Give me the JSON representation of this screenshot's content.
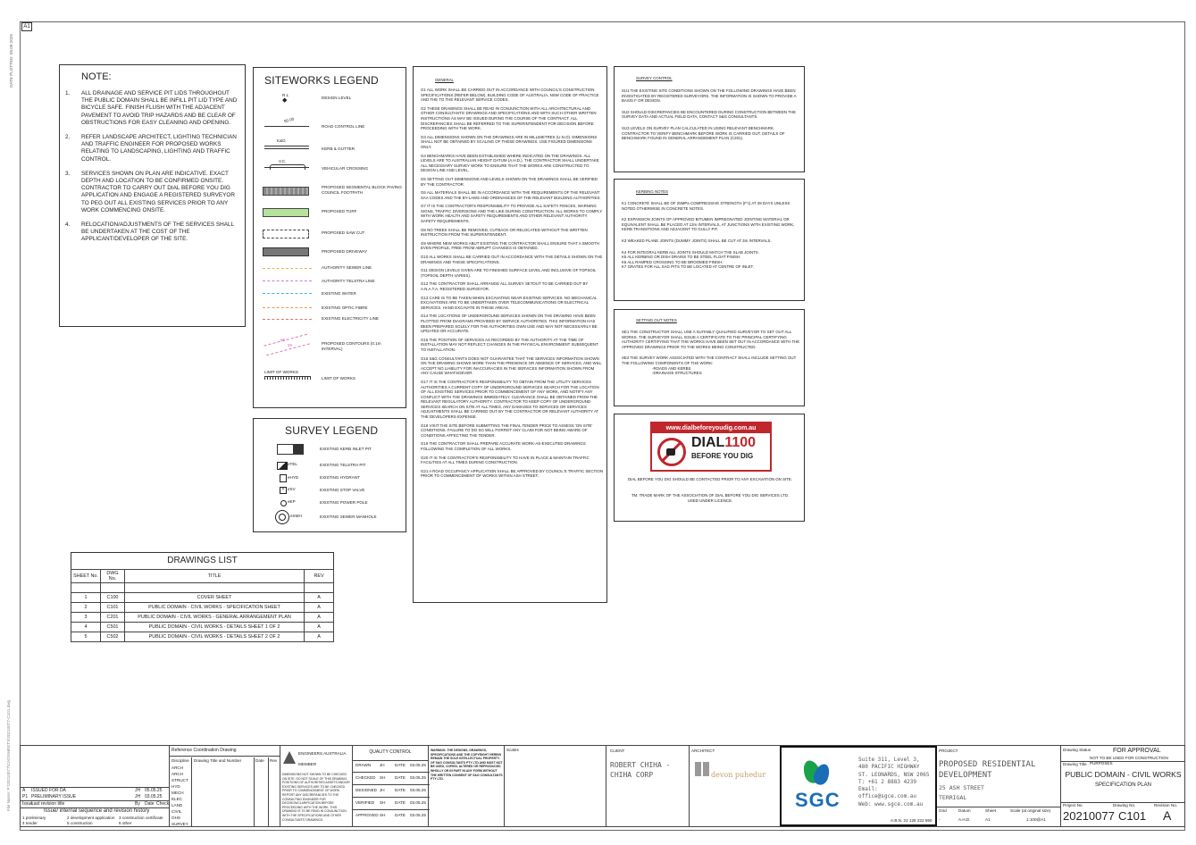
{
  "sheet_size": "A1",
  "side_text": "DATE PLOTTED: 05.05.2025",
  "side_text_2": "File Name: P:\\20210077\\CAD\\SHEETS\\20210077-C101.dwg",
  "note": {
    "title": "NOTE:",
    "items": [
      {
        "num": "1.",
        "text": "ALL DRAINAGE AND SERVICE PIT LIDS THROUGHOUT THE PUBLIC DOMAIN SHALL BE INFILL PIT LID TYPE AND BICYCLE SAFE. FINISH FLUSH WITH THE ADJACENT PAVEMENT TO AVOID TRIP HAZARDS AND BE CLEAR OF OBSTRUCTIONS FOR EASY CLEANING AND OPENING."
      },
      {
        "num": "2.",
        "text": "REFER LANDSCAPE ARCHITECT, LIGHTING TECHNICIAN AND TRAFFIC ENGINEER FOR PROPOSED WORKS RELATING TO LANDSCAPING, LIGHTING AND TRAFFIC CONTROL."
      },
      {
        "num": "3.",
        "text": "SERVICES SHOWN ON PLAN ARE INDICATIVE. EXACT DEPTH AND LOCATION TO BE CONFIRMED ONSITE. CONTRACTOR TO CARRY OUT DIAL BEFORE YOU DIG APPLICATION AND ENGAGE A REGISTERED SURVEYOR TO PEG OUT ALL EXISTING SERVICES PRIOR TO ANY WORK COMMENCING ONSITE."
      },
      {
        "num": "4.",
        "text": "RELOCATION/ADJUSTMENTS OF THE SERVICES SHALL BE UNDERTAKEN AT THE COST OF THE APPLICANT/DEVELOPER OF THE SITE."
      }
    ]
  },
  "siteworks_legend": {
    "title": "SITEWORKS LEGEND",
    "sym_rl": "R.L",
    "sym_rl_val": "4",
    "sym_road": "50.00",
    "sym_kg": "K&G",
    "sym_vc": "V.C.",
    "limit_text": "LIMIT OF WORKS",
    "contour_1": "88",
    "contour_2": "89",
    "items": [
      "DESIGN LEVEL",
      "ROAD CONTROL LINE",
      "KERB & GUTTER",
      "VEHICULAR CROSSING",
      "PROPOSED SEGMENTAL BLOCK PAVING COUNCIL FOOTPATH",
      "PROPOSED TURF",
      "PROPOSED SAW CUT",
      "PROPOSED DRIVEWAY",
      "AUTHORITY SEWER LINE",
      "AUTHORITY TELSTRA LINE",
      "EXISTING WATER",
      "EXISTING OPTIC FIBRE",
      "EXISTING ELECTRICITY LINE",
      "PROPOSED CONTOURS (0.1m INTERVAL)",
      "LIMIT OF WORKS"
    ]
  },
  "survey_legend": {
    "title": "SURVEY LEGEND",
    "items": [
      {
        "tag": "",
        "label": "EXISTING KERB INLET PIT"
      },
      {
        "tag": "eTEL",
        "label": "EXISTING TELSTRA PIT"
      },
      {
        "tag": "eHYD",
        "label": "EXISTING HYDRANT"
      },
      {
        "tag": "eSV",
        "label": "EXISTING STOP VALVE"
      },
      {
        "tag": "eEP",
        "label": "EXISTING POWER POLE"
      },
      {
        "tag": "eSMH",
        "label": "EXISTING SEWER MANHOLE"
      }
    ]
  },
  "drawings_list": {
    "title": "DRAWINGS LIST",
    "headers": [
      "SHEET No.",
      "DWG No.",
      "TITLE",
      "REV"
    ],
    "rows": [
      [
        "1",
        "C100",
        "COVER SHEET",
        "A"
      ],
      [
        "2",
        "C101",
        "PUBLIC DOMAIN - CIVIL WORKS - SPECIFICATION SHEET",
        "A"
      ],
      [
        "3",
        "C201",
        "PUBLIC DOMAIN - CIVIL WORKS - GENERAL ARRANGEMENT PLAN",
        "A"
      ],
      [
        "4",
        "C501",
        "PUBLIC DOMAIN - CIVIL WORKS - DETAILS SHEET 1 OF 2",
        "A"
      ],
      [
        "5",
        "C502",
        "PUBLIC DOMAIN - CIVIL WORKS - DETAILS SHEET 2 OF 2",
        "A"
      ]
    ]
  },
  "general": {
    "title": "GENERAL",
    "items": [
      "G1  ALL WORK SHALL BE CARRIED OUT IN ACCORDANCE WITH COUNCIL'S CONSTRUCTION SPECIFICATIONS (REFER BELOW), BUILDING CODE OF AUSTRALIA, NSW CODE OF PRACTICE AND THE TO THE RELEVANT SERVICE CODES.",
      "G2  THESE DRAWINGS SHALL BE READ IN CONJUNCTION WITH ALL ARCHITECTURAL AND OTHER CONSULTANTS' DRAWINGS AND SPECIFICATIONS AND WITH SUCH OTHER WRITTEN INSTRUCTIONS AS MAY BE ISSUED DURING THE COURSE OF THE CONTRACT. ALL DISCREPANCIES SHALL BE REFERRED TO THE SUPERINTENDENT FOR DECISION BEFORE PROCEEDING WITH THE WORK.",
      "G3  ALL DIMENSIONS SHOWN ON THE DRAWINGS ARE IN MILLIMETRES (U.N.O). DIMENSIONS SHALL NOT BE OBTAINED BY SCALING OF THESE DRAWINGS. USE FIGURED DIMENSIONS ONLY.",
      "G4  BENCHMARKS HAVE BEEN ESTABLISHED WHERE INDICATED ON THE DRAWINGS. ALL LEVELS ARE TO AUSTRALIAN HEIGHT DATUM (A.H.D.). THE CONTRACTOR SHALL UNDERTAKE ALL NECESSARY SURVEY WORK TO ENSURE THAT THE WORKS ARE CONSTRUCTED TO DESIGN LINE AND LEVEL.",
      "G5  SETTING OUT DIMENSIONS AND LEVELS SHOWN ON THE DRAWINGS SHALL BE VERIFIED BY THE CONTRACTOR.",
      "G6  ALL MATERIALS SHALL BE IN ACCORDANCE WITH THE REQUIREMENTS OF THE RELEVANT SAA CODES AND THE BY-LAWS AND ORDINANCES OF THE RELEVANT BUILDING AUTHORITIES.",
      "G7  IT IS THE CONTRACTOR'S RESPONSIBILITY TO PROVIDE ALL SAFETY FENCES, WARNING SIGNS, TRAFFIC DIVERSIONS AND THE LIKE DURING CONSTRUCTION. ALL WORKS TO COMPLY WITH WORK HEALTH AND SAFETY REQUIREMENTS AND OTHER RELEVANT AUTHORITY SAFETY REQUIREMENTS.",
      "G8  NO TREES SHALL BE REMOVED, CUTBACK OR RELOCATED WITHOUT THE WRITTEN INSTRUCTION FROM THE SUPERINTENDENT.",
      "G9  WHERE NEW WORKS ABUT EXISTING THE CONTRACTOR SHALL ENSURE THAT A SMOOTH EVEN PROFILE, FREE FROM ABRUPT CHANGES IS OBTAINED.",
      "G10  ALL WORKS SHALL BE CARRIED OUT IN ACCORDANCE WITH THE DETAILS SHOWN ON THE DRAWINGS AND THESE SPECIFICATIONS.",
      "G11  DESIGN LEVELS GIVEN ARE TO FINISHED SURFACE LEVEL AND INCLUSIVE OF TOPSOIL (TOPSOIL DEPTH VARIES).",
      "G12  THE CONTRACTOR SHALL ARRANGE ALL SURVEY SETOUT TO BE CARRIED OUT BY A.N.A.T.A. REGISTERED SURVEYOR.",
      "G13  CARE IS TO BE TAKEN WHEN EXCAVATING NEAR EXISTING SERVICES. NO MECHANICAL EXCAVATIONS ARE TO BE UNDERTAKEN OVER TELECOMMUNICATIONS OR ELECTRICAL SERVICES. HAND EXCAVATE IN THESE AREAS.",
      "G14  THE LOCATIONS OF UNDERGROUND SERVICES SHOWN ON THE DRAWING HAVE BEEN PLOTTED FROM DIAGRAMS PROVIDED BY SERVICE AUTHORITIES. THIS INFORMATION HAS BEEN PREPARED SOLELY FOR THE AUTHORITIES OWN USE AND MAY NOT NECESSARILY BE UPDATED OR ACCURATE.",
      "G15  THE POSITION OF SERVICES AS RECORDED BY THE AUTHORITY AT THE TIME OF INSTALLATION MAY NOT REFLECT CHANGES IN THE PHYSICAL ENVIRONMENT SUBSEQUENT TO INSTALLATION.",
      "G16  S&G CONSULTANTS DOES NOT GUARANTEE THAT THE SERVICES INFORMATION SHOWN ON THE DRAWING SHOWS MORE THAN THE PRESENCE OR ABSENCE OF SERVICES, AND WILL ACCEPT NO LIABILITY FOR INACCURACIES IN THE SERVICES INFORMATION SHOWN FROM ANY CAUSE WHATSOEVER.",
      "G17  IT IS THE CONTRACTOR'S RESPONSIBILITY TO OBTAIN FROM THE UTILITY SERVICES AUTHORITIES A CURRENT COPY OF UNDERGROUND SERVICES SEARCH FOR THE LOCATION OF ALL EXISTING SERVICES PRIOR TO COMMENCEMENT OF ANY WORK, AND NOTIFY ANY CONFLICT WITH THE DRAWINGS IMMEDIATELY. CLEARANCE SHALL BE OBTAINED FROM THE RELEVANT REGULATORY AUTHORITY. CONTRACTOR TO KEEP COPY OF UNDERGROUND SERVICES SEARCH ON SITE AT ALL TIMES. ANY DAMAGES TO SERVICES OR SERVICES ADJUSTMENTS SHALL BE CARRIED OUT BY THE CONTRACTOR OR RELEVANT AUTHORITY AT THE DEVELOPERS EXPENSE.",
      "G18  VISIT THE SITE BEFORE SUBMITTING THE FINAL TENDER PRICE TO ASSESS 'ON SITE' CONDITIONS. FAILURE TO DO SO WILL FORFEIT ANY CLAIM FOR NOT BEING AWARE OF CONDITIONS AFFECTING THE TENDER.",
      "G19  THE CONTRACTOR SHALL PREPARE ACCURATE WORK-AS-EXECUTED DRAWINGS FOLLOWING THE COMPLETION OF ALL WORKS.",
      "G20  IT IS THE CONTRACTOR'S RESPONSIBILITY TO HAVE IN PLACE & MAINTAIN TRAFFIC FACILITIES AT ALL TIMES DURING CONSTRUCTION.",
      "G21  A ROAD OCCUPANCY APPLICATION SHALL BE APPROVED BY COUNCIL'S TRAFFIC SECTION PRIOR TO COMMENCEMENT OF WORKS WITHIN ASH STREET."
    ]
  },
  "survey_control": {
    "title": "SURVEY CONTROL",
    "items": [
      "SU1  THE EXISTING SITE CONDITIONS SHOWN ON THE FOLLOWING DRAWINGS HAVE BEEN INVESTIGATED BY REGISTERED SURVEYORS. THE INFORMATION IS SHOWN TO PROVIDE A BASIS F OR DESIGN.",
      "SU2  SHOULD DISCREPANCIES BE ENCOUNTERED DURING CONSTRUCTION BETWEEN THE SURVEY DATA AND ACTUAL FIELD DATA, CONTACT S&G CONSULTANTS.",
      "SU3  LEVELS ON SURVEY PLAN CALCULATED IN USING RELEVANT BENCHMARK. CONTRACTOR TO VERIFY BENCHMARK BEFORE WORK IS CARRIED OUT. DETAILS OF BENCHMARK FOUND IN GENERAL ARRANGEMENT PLAN (C201)."
    ]
  },
  "kerbing_notes": {
    "title": "KERBING NOTES",
    "items": [
      "K1  CONCRETE SHALL BE OF 25MPa COMPRESSIVE STRENGTH (F'c) AT 28 DAYS UNLESS NOTED OTHERWISE IN CONCRETE NOTES.",
      "K2  EXPANSION JOINTS OF APPROVED BITUMEN IMPREGNATED JOINTING MATERIAL OR EQUIVALENT SHALL BE PLACED AT 12m INTERVALS, AT JUNCTIONS WITH EXISTING WORK, KERB TRANSITIONS AND ADJACENT TO GULLY PIT.",
      "K3  WEAKED PLANE JOINTS (DUMMY JOINTS) SHALL BE CUT AT 3m INTERVALS.",
      "K4  FOR INTEGRAL KERB ALL JOINTS SHOULD MATCH THE SLAB JOINTS.",
      "K5  ALL KERBING OR DISH DRAINS TO BE STEEL FLOAT FINISH.",
      "K6  ALL RAMPED CROSSING TO BE BROOMED FINISH.",
      "K7  GRATES FOR ALL SAG PITS TO BE LOCATED AT CENTRE OF INLET."
    ]
  },
  "setting_out": {
    "title": "SETTING OUT NOTES",
    "items": [
      "SE1  THE CONSTRUCTOR SHALL USE A SUITABLY QUALIFIED SURVEYOR TO SET OUT ALL WORKS. THE SURVEYOR SHALL ISSUE A CERTIFICATE TO THE PRINCIPAL CERTIFYING AUTHORITY CERTIFYING THAT THE WORKS HAVE BEEN SET OUT IN ACCORDANCE WITH THE APPROVED DRAWINGS PRIOR TO THE WORKS BEING CONSTRUCTED.",
      "SE2  THE SURVEY WORK ASSOCIATED WITH THE CONTRACT SHALL INCLUDE SETTING OUT THE FOLLOWING COMPONENTS OF THE WORK:",
      "-ROADS AND KERBS",
      "-DRAINAGE STRUCTURES"
    ]
  },
  "dbyd": {
    "url": "www.dialbeforeyoudig.com.au",
    "big1": "DIAL",
    "big2": "1100",
    "sub": "BEFORE YOU DIG",
    "text1": "DIAL BEFORE YOU DIG SHOULD BE CONTACTED PRIOR TO ANY EXCAVATION ON SITE.",
    "text2": "TM: TRADE MARK OF THE ASSOCIATION OF DIAL BEFORE YOU DIG SERVICES LTD. USED UNDER LICENCE."
  },
  "title_block": {
    "revisions_title": "Issue/ internal sequence and revision history",
    "rev_rows": [
      [
        "A",
        "ISSUED FOR DA",
        "JH",
        "05.05.25"
      ],
      [
        "P1",
        "PRELIMINARY ISSUE",
        "JH",
        "03.05.25"
      ]
    ],
    "rev_headers": [
      "Issue",
      "Last revision title",
      "By",
      "Date",
      "Check"
    ],
    "rev_legend": [
      "1 preliminary",
      "2 development application",
      "3 construction certificate",
      "4 tender",
      "5 construction",
      "6 other"
    ],
    "ref_title": "Reference Coordination Drawing",
    "ref_headers": [
      "Discipline",
      "Drawing Title and Number",
      "Date",
      "Rev"
    ],
    "ref_rows": [
      "ARCH",
      "ARCH",
      "STRUCT",
      "HYD",
      "MECH",
      "ELEC",
      "LAND",
      "CIVIL",
      "OHS",
      "SURVEY"
    ],
    "ea_text": "ENGINEERS AUSTRALIA",
    "ea_sub": "MEMBER",
    "ea_note": "DIMENSIONS NOT SHOWN TO BE CHECKED ON SITE. DO NOT SCALE OF THIS DRAWING. POSITIONS OF AUTHORITIES ASSETS AND/OR EXISTING SERVICES ARE TO BE CHECKED PRIOR TO COMMENCEMENT OF WORK. REPORT ANY DISCREPANCIES TO THE CONSULTING ENGINEER FOR DECISION/CLARIFICATION BEFORE PROCEEDING WITH THE WORK. THIS DRAWING IS TO BE READ IN CONJUNCTION WITH THE SPECIFICATIONS AND OTHER CONSULTANTS' DRAWINGS.",
    "qc_title": "QUALITY CONTROL",
    "qc_rows": [
      [
        "DRAWN",
        "JH",
        "DATE",
        "03.05.25"
      ],
      [
        "CHECKED",
        "SH",
        "DATE",
        "03.05.25"
      ],
      [
        "DESIGNED",
        "JH",
        "DATE",
        "03.05.25"
      ],
      [
        "VERIFIED",
        "SH",
        "DATE",
        "03.05.25"
      ],
      [
        "APPROVED",
        "SH",
        "DATE",
        "03.05.25"
      ]
    ],
    "warning": "WARNING: THE DESIGNS, DRAWINGS, SPECIFICATIONS AND THE COPYRIGHT HEREIN REMAIN THE SOLE INTELLECTUAL PROPERTY OF S&G CONSULTANTS PTY LTD AND MUST NOT BE USED, COPIED, ALTERED OR REPRODUCED WHOLLY OR IN PART IN ANY FORM WITHOUT THE WRITTEN CONSENT OF S&G CONSULTANTS PTY LTD.",
    "scales": "Scales",
    "client_label": "CLIENT",
    "client": "ROBERT CHIHA - CHIHA CORP",
    "architect_label": "ARCHITECT",
    "architect_logo": "devon puhedur",
    "sgc": "SGC",
    "sgc_address": [
      "Suite 311, Level 3,",
      "480 PACIFIC HIGHWAY",
      "ST. LEONARDS, NSW 2065",
      "T: +61 2 8883 4239",
      "Email: office@sgce.com.au",
      "Web: www.sgce.com.au"
    ],
    "abn": "A.B.N. 22 128 222 550",
    "project_label": "PROJECT",
    "project": "PROPOSED RESIDENTIAL DEVELOPMENT",
    "address": "25 ASH STREET",
    "suburb": "TERRIGAL",
    "status_label": "Drawing Status",
    "status": "FOR APPROVAL",
    "status_sub": "NOT TO BE USED FOR CONSTRUCTION PURPOSES",
    "drawing_title_label": "Drawing Title",
    "drawing_title": "PUBLIC DOMAIN - CIVIL WORKS",
    "drawing_subtitle": "SPECIFICATION PLAN",
    "grid_headers": [
      "Grid",
      "Datum",
      "Sheet",
      "Scale (at original size)"
    ],
    "grid_values": [
      "-",
      "A.H.D.",
      "A1",
      "1:100@A1"
    ],
    "project_no_label": "Project No.",
    "drawing_no_label": "Drawing No.",
    "revision_label": "Revision No.",
    "project_no": "20210077",
    "drawing_no": "C101",
    "revision": "A"
  },
  "colors": {
    "turf": "#b6e29c",
    "sewer": "#e8b24c",
    "telstra": "#c080d8",
    "water": "#36b6e0",
    "optic": "#e79a4a",
    "electric": "#e07070",
    "contour": "#e070c0",
    "sgc_green": "#19a24b",
    "sgc_blue": "#1b6eb5"
  }
}
